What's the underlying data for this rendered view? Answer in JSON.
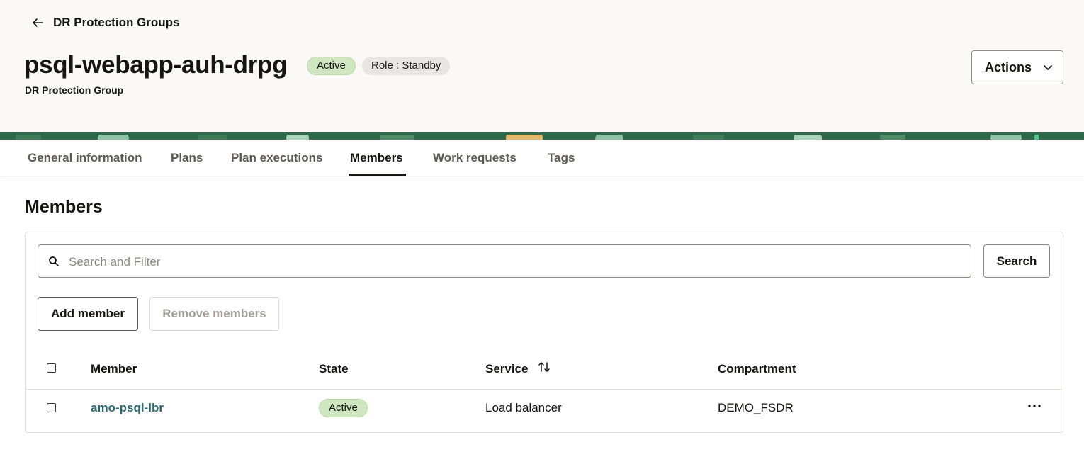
{
  "header": {
    "back_label": "DR Protection Groups",
    "title": "psql-webapp-auh-drpg",
    "subtitle": "DR Protection Group",
    "status_badge": "Active",
    "role_badge": "Role : Standby",
    "actions_label": "Actions"
  },
  "tabs": [
    {
      "label": "General information"
    },
    {
      "label": "Plans"
    },
    {
      "label": "Plan executions"
    },
    {
      "label": "Members"
    },
    {
      "label": "Work requests"
    },
    {
      "label": "Tags"
    }
  ],
  "active_tab": "Members",
  "main": {
    "section_title": "Members",
    "search_placeholder": "Search and Filter",
    "search_button": "Search",
    "add_button": "Add member",
    "remove_button": "Remove members"
  },
  "table": {
    "columns": [
      "Member",
      "State",
      "Service",
      "Compartment"
    ],
    "rows": [
      {
        "member": "amo-psql-lbr",
        "state": "Active",
        "service": "Load balancer",
        "compartment": "DEMO_FSDR"
      }
    ]
  },
  "icons": {
    "back": "arrow-left-icon",
    "actions": "chevron-down-icon",
    "search": "search-icon",
    "sort": "sort-icon",
    "row_actions": "more-horizontal-icon"
  },
  "colors": {
    "header_bg": "#fbf9f8",
    "active_badge": "#cfe6c1",
    "role_badge": "#e8e6e4",
    "link": "#2c6a73",
    "text": "#161513"
  }
}
